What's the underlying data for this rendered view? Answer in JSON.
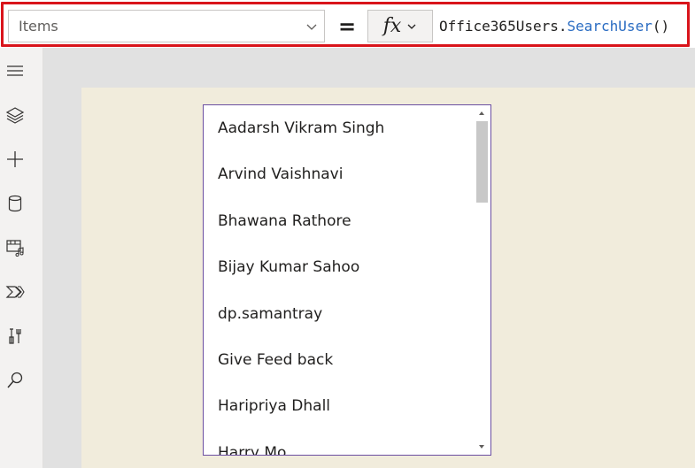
{
  "formula_bar": {
    "property": "Items",
    "equals": "=",
    "fx_label": "fx",
    "formula_prefix": "Office365Users.",
    "formula_function": "SearchUser",
    "formula_suffix": "()"
  },
  "left_rail": {
    "icons": [
      "hamburger-menu-icon",
      "layers-icon",
      "insert-plus-icon",
      "data-cylinder-icon",
      "media-icon",
      "power-automate-icon",
      "advanced-tools-icon",
      "search-icon"
    ]
  },
  "gallery": {
    "items": [
      "Aadarsh Vikram Singh",
      "Arvind Vaishnavi",
      "Bhawana Rathore",
      "Bijay Kumar Sahoo",
      "dp.samantray",
      "Give Feed back",
      "Haripriya Dhall",
      "Harry Mo"
    ],
    "scroll_position": 0.0
  },
  "colors": {
    "highlight": "#d9141b",
    "canvas_bg": "#f1ecdc",
    "gallery_border": "#6b4ea1",
    "function_color": "#2a6cc2"
  }
}
